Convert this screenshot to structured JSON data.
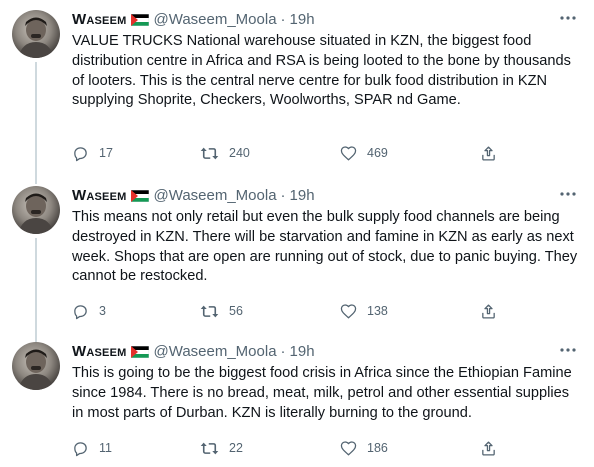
{
  "tweets": [
    {
      "author_name": "Waseem",
      "handle": "@Waseem_Moola",
      "separator": "·",
      "time": "19h",
      "text": "VALUE TRUCKS National warehouse situated in KZN, the biggest food distribution centre in Africa and RSA  is being looted to the bone by thousands of looters. This is the central nerve centre for bulk food distribution in KZN supplying Shoprite, Checkers, Woolworths, SPAR nd Game.",
      "replies": "17",
      "retweets": "240",
      "likes": "469"
    },
    {
      "author_name": "Waseem",
      "handle": "@Waseem_Moola",
      "separator": "·",
      "time": "19h",
      "text": "This means not only retail but even the bulk supply food channels are being destroyed in KZN. There will be starvation and famine in KZN as early as next week. Shops that are open are running out of stock, due to panic buying. They cannot be restocked.",
      "replies": "3",
      "retweets": "56",
      "likes": "138"
    },
    {
      "author_name": "Waseem",
      "handle": "@Waseem_Moola",
      "separator": "·",
      "time": "19h",
      "text": "This is going to be the biggest food crisis in Africa since the Ethiopian Famine since 1984. There is no bread, meat, milk, petrol and other essential supplies in most  parts of Durban. KZN is literally burning to the ground.",
      "replies": "11",
      "retweets": "22",
      "likes": "186"
    }
  ],
  "icons": {
    "more": "more-options-icon",
    "reply": "reply-icon",
    "retweet": "retweet-icon",
    "like": "like-icon",
    "share": "share-icon",
    "flag": "palestine-flag-icon"
  },
  "colors": {
    "text": "#0f1419",
    "muted": "#536471",
    "thread_line": "#cfd9de",
    "flag_black": "#000000",
    "flag_white": "#ffffff",
    "flag_green": "#149954",
    "flag_red": "#e4312b"
  }
}
